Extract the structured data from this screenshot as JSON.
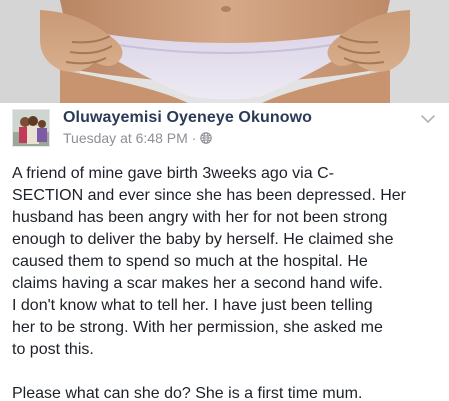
{
  "post": {
    "author_name": "Oluwayemisi Oyeneye Okunowo",
    "timestamp": "Tuesday at 6:48 PM",
    "separator": "·",
    "privacy_icon": "globe-icon",
    "menu_icon": "chevron-down-icon",
    "body_lines": [
      "A friend of mine gave birth 3weeks ago via C-",
      "SECTION and ever since she has been depressed. Her",
      "husband has been angry with her  for not been strong",
      "enough to deliver the baby by herself. He claimed she",
      "caused them to spend so much at the hospital. He",
      "claims having a scar makes her a second hand wife.",
      "I don't know what to tell her. I have just been telling",
      "her to be strong. With her permission, she asked me",
      "to post this."
    ],
    "closing_line": "Please what can she do? She is a first time mum."
  },
  "colors": {
    "author_name": "#2b3a57",
    "meta_text": "#8c8f95",
    "body_text": "#1d2129"
  }
}
